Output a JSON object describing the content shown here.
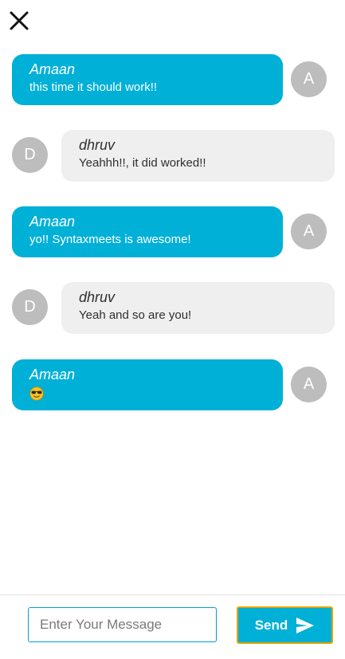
{
  "close": {
    "icon": "close-icon"
  },
  "messages": [
    {
      "sender": "Amaan",
      "text": "this time it should work!!",
      "avatar": "A",
      "side": "right"
    },
    {
      "sender": "dhruv",
      "text": "Yeahhh!!, it did worked!!",
      "avatar": "D",
      "side": "left"
    },
    {
      "sender": "Amaan",
      "text": "yo!! Syntaxmeets is awesome!",
      "avatar": "A",
      "side": "right"
    },
    {
      "sender": "dhruv",
      "text": "Yeah and so are you!",
      "avatar": "D",
      "side": "left"
    },
    {
      "sender": "Amaan",
      "text": "",
      "emoji": "smiling-face-with-sunglasses",
      "avatar": "A",
      "side": "right"
    }
  ],
  "composer": {
    "placeholder": "Enter Your Message",
    "value": "",
    "send_label": "Send",
    "send_icon": "send-icon"
  },
  "colors": {
    "accent": "#00b0d6",
    "incoming_bubble": "#efefef",
    "avatar": "#bdbdbd",
    "send_border": "#e2a400"
  }
}
